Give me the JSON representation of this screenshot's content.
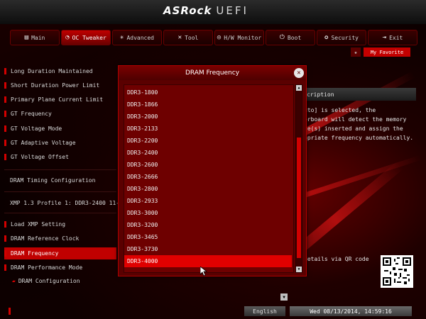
{
  "header": {
    "brand": "ASRock",
    "product": "UEFI"
  },
  "tabs": [
    {
      "label": "Main",
      "icon": "main-icon",
      "active": false
    },
    {
      "label": "OC Tweaker",
      "icon": "oc-icon",
      "active": true
    },
    {
      "label": "Advanced",
      "icon": "advanced-icon",
      "active": false
    },
    {
      "label": "Tool",
      "icon": "tool-icon",
      "active": false
    },
    {
      "label": "H/W Monitor",
      "icon": "monitor-icon",
      "active": false
    },
    {
      "label": "Boot",
      "icon": "boot-icon",
      "active": false
    },
    {
      "label": "Security",
      "icon": "security-icon",
      "active": false
    },
    {
      "label": "Exit",
      "icon": "exit-icon",
      "active": false
    }
  ],
  "favorite": {
    "label": "My Favorite"
  },
  "menu": [
    "Long Duration Maintained",
    "Short Duration Power Limit",
    "Primary Plane Current Limit",
    "GT Frequency",
    "GT Voltage Mode",
    "GT Adaptive Voltage",
    "GT Voltage Offset",
    "DRAM Timing Configuration",
    "XMP 1.3 Profile 1: DDR3-2400 11-",
    "Load XMP Setting",
    "DRAM Reference Clock",
    "DRAM Frequency",
    "DRAM Performance Mode",
    "DRAM Configuration"
  ],
  "description": {
    "heading": "cription",
    "text": "uto] is selected, the\nerboard will detect the memory\nle(s) inserted and assign the\nopriate frequency automatically.",
    "qr_label": "details via QR code"
  },
  "popup": {
    "title": "DRAM Frequency",
    "options": [
      "DDR3-1800",
      "DDR3-1866",
      "DDR3-2000",
      "DDR3-2133",
      "DDR3-2200",
      "DDR3-2400",
      "DDR3-2600",
      "DDR3-2666",
      "DDR3-2800",
      "DDR3-2933",
      "DDR3-3000",
      "DDR3-3200",
      "DDR3-3465",
      "DDR3-3730",
      "DDR3-4000"
    ],
    "selected": "DDR3-4000"
  },
  "footer": {
    "language": "English",
    "datetime": "Wed 08/13/2014, 14:59:16"
  },
  "colors": {
    "accent": "#d40000",
    "selected": "#e00000",
    "background": "#0b0000"
  }
}
